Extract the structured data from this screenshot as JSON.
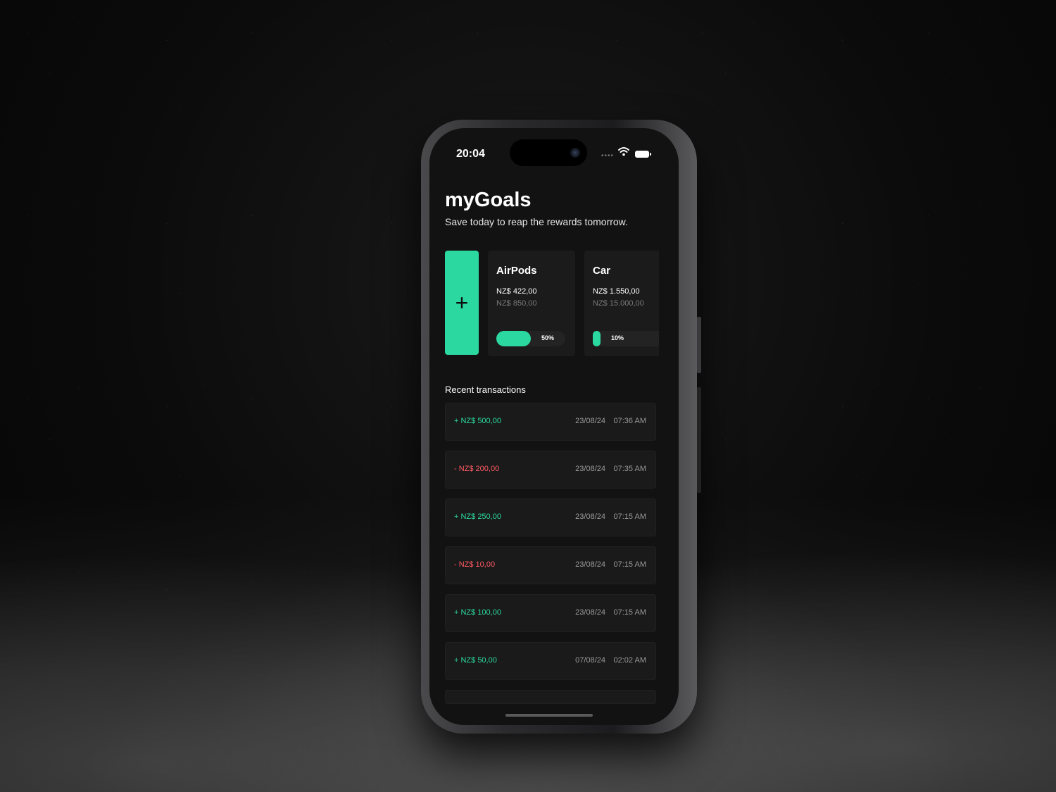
{
  "status_bar": {
    "time": "20:04",
    "signal_dots": "••••"
  },
  "header": {
    "title": "myGoals",
    "subtitle": "Save today to reap the rewards tomorrow."
  },
  "add_goal": {
    "label": "+"
  },
  "goals": [
    {
      "name": "AirPods",
      "saved": "NZ$ 422,00",
      "target": "NZ$ 850,00",
      "progress_label": "50%",
      "progress": 0.5
    },
    {
      "name": "Car",
      "saved": "NZ$ 1.550,00",
      "target": "NZ$ 15.000,00",
      "progress_label": "10%",
      "progress": 0.1
    }
  ],
  "transactions_title": "Recent transactions",
  "transactions": [
    {
      "amount": "+ NZ$ 500,00",
      "date": "23/08/24",
      "time": "07:36 AM",
      "type": "in"
    },
    {
      "amount": "- NZ$ 200,00",
      "date": "23/08/24",
      "time": "07:35 AM",
      "type": "out"
    },
    {
      "amount": "+ NZ$ 250,00",
      "date": "23/08/24",
      "time": "07:15 AM",
      "type": "in"
    },
    {
      "amount": "- NZ$ 10,00",
      "date": "23/08/24",
      "time": "07:15 AM",
      "type": "out"
    },
    {
      "amount": "+ NZ$ 100,00",
      "date": "23/08/24",
      "time": "07:15 AM",
      "type": "in"
    },
    {
      "amount": "+ NZ$ 50,00",
      "date": "07/08/24",
      "time": "02:02 AM",
      "type": "in"
    }
  ],
  "colors": {
    "accent": "#2bd9a0",
    "negative": "#ff5a63",
    "background": "#121212",
    "card": "#1b1b1b"
  }
}
